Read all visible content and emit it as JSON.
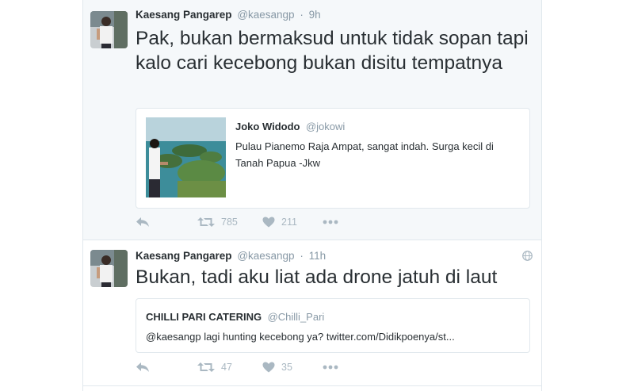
{
  "tweets": [
    {
      "name": "Kaesang Pangarep",
      "handle": "@kaesangp",
      "dot": "·",
      "time": "9h",
      "text": "Pak, bukan bermaksud untuk tidak sopan tapi kalo cari kecebong bukan disitu tempatnya",
      "quote": {
        "name": "Joko Widodo",
        "handle": "@jokowi",
        "text": "Pulau Pianemo Raja Ampat, sangat indah. Surga kecil di Tanah Papua -Jkw"
      },
      "retweets": "785",
      "likes": "211"
    },
    {
      "name": "Kaesang Pangarep",
      "handle": "@kaesangp",
      "dot": "·",
      "time": "11h",
      "text": "Bukan, tadi aku liat ada drone jatuh di laut",
      "quote": {
        "name": "CHILLI PARI CATERING",
        "handle": "@Chilli_Pari",
        "text": "@kaesangp lagi hunting kecebong ya? twitter.com/Didikpoenya/st..."
      },
      "retweets": "47",
      "likes": "35"
    }
  ],
  "icons": {
    "reply": "reply-icon",
    "retweet": "retweet-icon",
    "like": "heart-icon",
    "more": "more-icon",
    "globe": "globe-icon"
  },
  "colors": {
    "text": "#292f33",
    "muted": "#8899a6",
    "action": "#aab8c2",
    "border": "#e1e8ed",
    "highlight_bg": "#f5f8fa"
  }
}
